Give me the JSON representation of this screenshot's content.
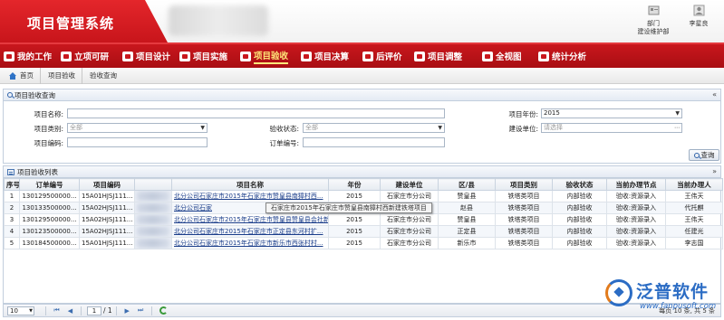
{
  "header": {
    "app_title": "项目管理系统",
    "dept_label": "部门",
    "dept_value": "建设维护部",
    "user_name": "李星良"
  },
  "nav": {
    "items": [
      {
        "label": "我的工作"
      },
      {
        "label": "立项可研"
      },
      {
        "label": "项目设计"
      },
      {
        "label": "项目实施"
      },
      {
        "label": "项目验收"
      },
      {
        "label": "项目决算"
      },
      {
        "label": "后评价"
      },
      {
        "label": "项目调整"
      },
      {
        "label": "全视图"
      },
      {
        "label": "统计分析"
      }
    ],
    "active_index": 4
  },
  "breadcrumb": [
    "首页",
    "项目验收",
    "验收查询"
  ],
  "search": {
    "title": "项目验收查询",
    "collapse_icon": "double-chevron-up-icon",
    "fields": {
      "name_label": "项目名称:",
      "category_label": "项目类别:",
      "category_value": "全部",
      "code_label": "项目编码:",
      "status_label": "验收状态:",
      "status_value": "全部",
      "order_label": "订单编号:",
      "year_label": "项目年份:",
      "year_value": "2015",
      "unit_label": "建设单位:",
      "unit_placeholder": "请选择"
    },
    "query_button": "查询"
  },
  "list": {
    "title": "项目验收列表",
    "collapse_icon": "double-chevron-down-icon",
    "columns": [
      "序号",
      "订单编号",
      "项目编码",
      "项目名称",
      "年份",
      "建设单位",
      "区/县",
      "项目类别",
      "验收状态",
      "当前办理节点",
      "当前办理人"
    ],
    "rows": [
      {
        "no": "1",
        "order": "130129500000...",
        "code": "15A01HJSJ111...",
        "name": "北分公司石家庄市2015年石家庄市赞皇县南獐村西...",
        "year": "2015",
        "unit": "石家庄市分公司",
        "county": "赞皇县",
        "category": "铁塔类项目",
        "status": "内部验收",
        "node": "验收:资源录入",
        "person": "王伟天"
      },
      {
        "no": "2",
        "order": "130133500000...",
        "code": "15A02HJSJ111...",
        "name": "北分公司石家",
        "year": "",
        "unit": "",
        "county": "赵县",
        "category": "铁塔类项目",
        "status": "内部验收",
        "node": "验收:资源录入",
        "person": "代托麒"
      },
      {
        "no": "3",
        "order": "130129500000...",
        "code": "15A02HJSJ111...",
        "name": "北分公司石家庄市2015年石家庄市赞皇县赞皇县会社新...",
        "year": "2015",
        "unit": "石家庄市分公司",
        "county": "赞皇县",
        "category": "铁塔类项目",
        "status": "内部验收",
        "node": "验收:资源录入",
        "person": "王伟天"
      },
      {
        "no": "4",
        "order": "130123500000...",
        "code": "15A02HJSJ111...",
        "name": "北分公司石家庄市2015年石家庄市正定县东河村扩...",
        "year": "2015",
        "unit": "石家庄市分公司",
        "county": "正定县",
        "category": "铁塔类项目",
        "status": "内部验收",
        "node": "验收:资源录入",
        "person": "任建光"
      },
      {
        "no": "5",
        "order": "130184500000...",
        "code": "15A01HJSJ111...",
        "name": "北分公司石家庄市2015年石家庄市新乐市西张村村...",
        "year": "2015",
        "unit": "石家庄市分公司",
        "county": "新乐市",
        "category": "铁塔类项目",
        "status": "内部验收",
        "node": "验收:资源录入",
        "person": "李志国"
      }
    ],
    "tooltip": "石家庄市2015年石家庄市赞皇县南獐村西新建铁塔项目"
  },
  "pager": {
    "page_size": "10",
    "current_page": "1",
    "total_pages_text": "/ 1",
    "info": "每页 10 条, 共 5 条"
  },
  "watermark": {
    "brand": "泛普软件",
    "url": "www.fanpusoft.com"
  },
  "colors": {
    "brand_red": "#c9171d",
    "active_nav": "#ffe97a",
    "link_blue": "#1a3d8a"
  }
}
